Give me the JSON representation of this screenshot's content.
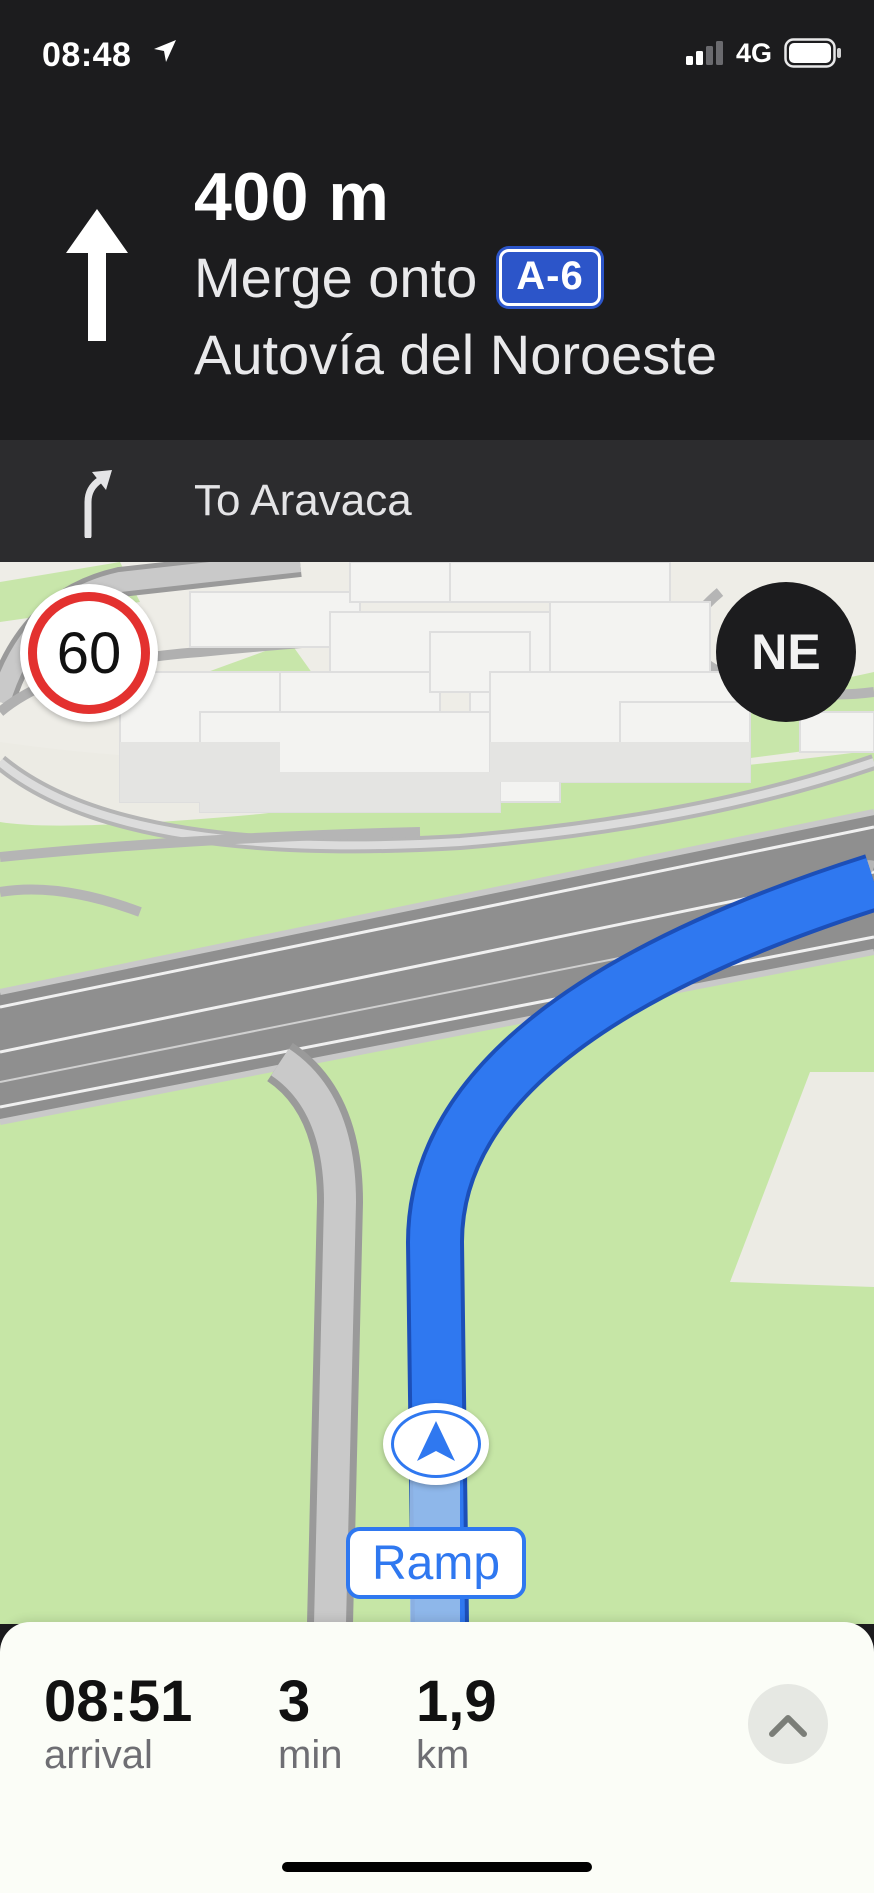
{
  "status": {
    "time": "08:48",
    "network": "4G"
  },
  "guidance": {
    "distance": "400 m",
    "instruction_prefix": "Merge onto",
    "route_shield": "A-6",
    "road_name": "Autovía del Noroeste",
    "secondary_instruction": "To Aravaca"
  },
  "map": {
    "speed_limit": "60",
    "compass_heading": "NE",
    "current_road_label": "Ramp"
  },
  "trip": {
    "arrival_value": "08:51",
    "arrival_label": "arrival",
    "time_value": "3",
    "time_label": "min",
    "distance_value": "1,9",
    "distance_label": "km"
  },
  "colors": {
    "route": "#2f78f0",
    "header_bg": "#1c1c1e",
    "speed_ring": "#e3312f",
    "shield": "#2c55c9"
  }
}
